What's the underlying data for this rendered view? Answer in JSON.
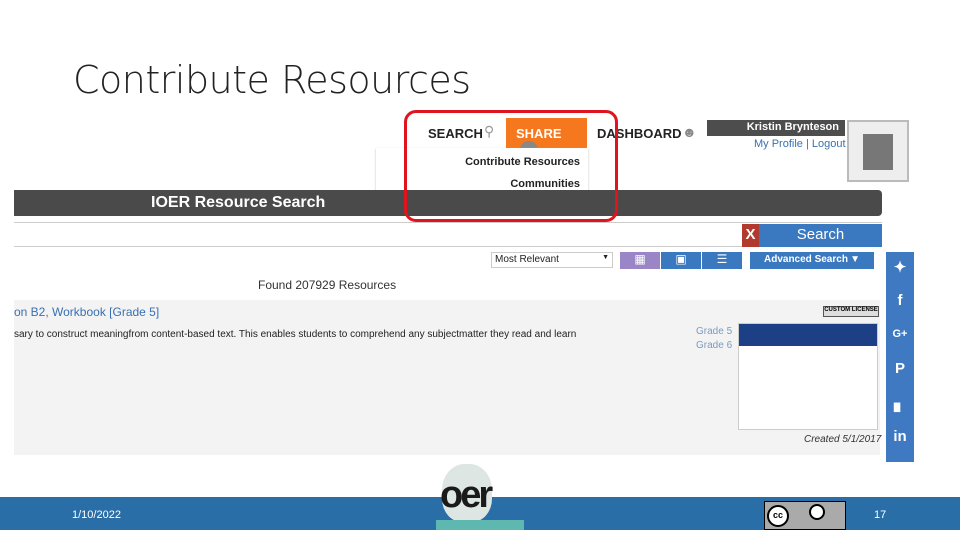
{
  "slide": {
    "title": "Contribute Resources",
    "date": "1/10/2022",
    "page_number": "17"
  },
  "screenshot": {
    "nav": {
      "search": "SEARCH",
      "share": "SHARE",
      "dashboard": "DASHBOARD"
    },
    "share_menu": [
      "Contribute Resources",
      "Communities"
    ],
    "user": {
      "name": "Kristin Brynteson",
      "profile": "My Profile",
      "logout": "Logout"
    },
    "header": "IOER Resource Search",
    "search": {
      "clear": "X",
      "button": "Search"
    },
    "sort": "Most Relevant",
    "advanced": "Advanced Search",
    "found": "Found 207929 Resources",
    "result": {
      "title": "on B2, Workbook [Grade 5]",
      "description": "sary to construct meaningfrom content-based text. This enables students to comprehend any subjectmatter they read and learn",
      "grades": [
        "Grade 5",
        "Grade 6"
      ],
      "license": "CUSTOM LICENSE",
      "created": "Created 5/1/2017"
    },
    "social": [
      "twitter",
      "facebook",
      "google-plus",
      "pinterest",
      "flipboard",
      "linkedin"
    ]
  },
  "colors": {
    "share": "#f5781e",
    "accent": "#3a78c0",
    "highlight": "#e0141e",
    "footer": "#2a6ea8"
  }
}
